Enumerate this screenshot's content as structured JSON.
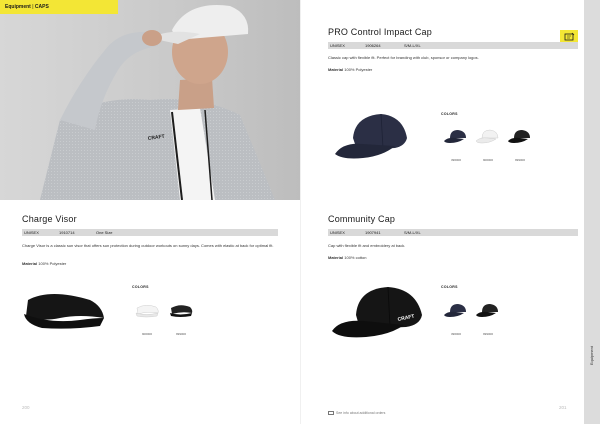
{
  "tab": {
    "brand": "Equipment",
    "section": "CAPS"
  },
  "hero": {
    "logo_text": "CRAFT"
  },
  "products": {
    "pro": {
      "title": "PRO Control Impact Cap",
      "spec": {
        "label": "UNISEX",
        "code": "1906264",
        "size": "S/M-L/XL"
      },
      "desc": "Classic cap with flexible fit. Perfect for branding with club, sponsor or company logos.",
      "material_label": "Material",
      "material_value": "100% Polyester",
      "colors_label": "COLORS",
      "swatches": [
        {
          "code": "396000",
          "color": "#2b2f45"
        },
        {
          "code": "900000",
          "color": "#f2f2f2"
        },
        {
          "code": "999000",
          "color": "#222222"
        }
      ]
    },
    "visor": {
      "title": "Charge Visor",
      "spec": {
        "label": "UNISEX",
        "code": "1910714",
        "size": "One Size"
      },
      "desc": "Charge Visor is a classic sun visor that offers sun protection during outdoor workouts on sunny days. Comes with elastic at back for optimal fit.",
      "material_label": "Material",
      "material_value": "100% Polyester",
      "colors_label": "COLORS",
      "swatches": [
        {
          "code": "900000",
          "color": "#f4f4f4"
        },
        {
          "code": "999000",
          "color": "#222222"
        }
      ]
    },
    "community": {
      "title": "Community Cap",
      "spec": {
        "label": "UNISEX",
        "code": "1907941",
        "size": "S/M-L/XL"
      },
      "desc": "Cap with flexible fit and embroidery at back.",
      "material_label": "Material",
      "material_value": "100% cotton",
      "colors_label": "COLORS",
      "swatches": [
        {
          "code": "396000",
          "color": "#2b2f45"
        },
        {
          "code": "999000",
          "color": "#222222"
        }
      ]
    }
  },
  "pages": {
    "left": "200",
    "right": "201"
  },
  "side_tab": "Equipment",
  "footer_note": "See info about additional orders",
  "colors": {
    "accent": "#f3e635",
    "bar": "#d9d9d9"
  }
}
